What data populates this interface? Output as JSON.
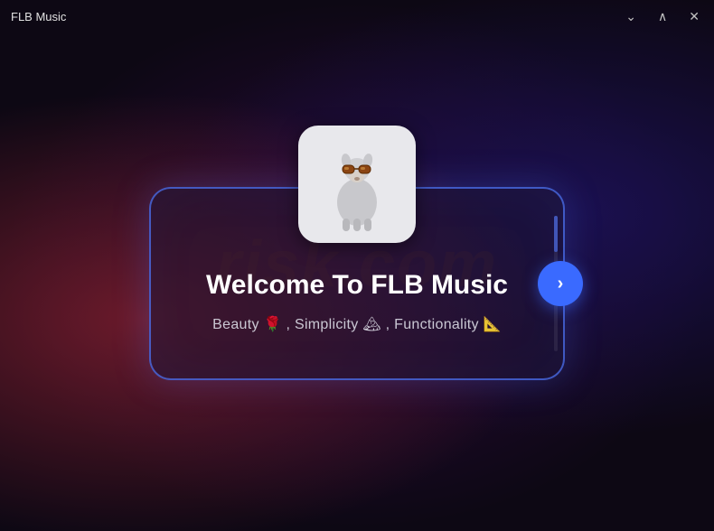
{
  "titlebar": {
    "title": "FLB Music",
    "minimize_label": "🗕",
    "maximize_label": "🗖",
    "close_label": "✕",
    "chevron_down": "⌄",
    "chevron_up": "^"
  },
  "card": {
    "welcome_title": "Welcome To FLB Music",
    "subtitle": "Beauty 🌹 , Simplicity 🏔 , Functionality 📐",
    "next_button_label": "›"
  },
  "watermark": {
    "line1": "risk.com"
  }
}
